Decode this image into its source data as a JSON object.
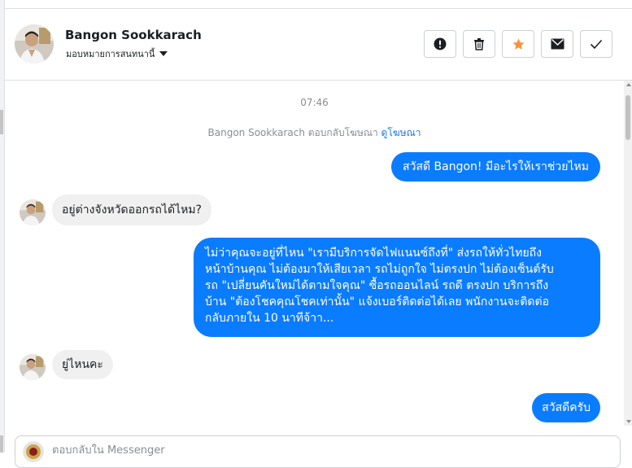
{
  "contact": {
    "name": "Bangon Sookkarach",
    "assign_label": "มอบหมายการสนทนานี้"
  },
  "toolbar": {
    "icons": [
      "exclamation-icon",
      "trash-icon",
      "star-icon",
      "envelope-icon",
      "check-icon"
    ],
    "star_color": "#f7923b"
  },
  "chat": {
    "timestamp": "07:46",
    "system_text": "Bangon Sookkarach ตอบกลับโฆษณา",
    "system_link": "ดูโฆษณา",
    "messages": [
      {
        "dir": "out",
        "text": "สวัสดี Bangon! มีอะไรให้เราช่วยไหม"
      },
      {
        "dir": "in",
        "text": "อยู่ต่างจังหวัดออกรถได้ไหม?"
      },
      {
        "dir": "out",
        "lines": [
          "ไม่ว่าคุณจะอยู่ที่ไหน \"เรามีบริการจัดไฟแนนซ์ถึงที่\"  ส่งรถให้ทั่วไทยถึง",
          "หน้าบ้านคุณ ไม่ต้องมาให้เสียเวลา รถไม่ถูกใจ ไม่ตรงปก ไม่ต้องเซ็นต์รับ",
          "รถ \"เปลี่ยนคันใหม่ได้ตามใจคุณ\" ซื้อรถออนไลน์ รถดี ตรงปก บริการถึง",
          "บ้าน \"ต้องโชคคุณโชคเท่านั้น\" แจ้งเบอร์ติดต่อได้เลย พนักงานจะติดต่อ",
          "กลับภายใน 10 นาทีจ้าา..."
        ]
      },
      {
        "dir": "in",
        "text": "ยู่ไหนคะ"
      },
      {
        "dir": "out",
        "text": "สวัสดีครับ"
      }
    ]
  },
  "composer": {
    "placeholder": "ตอบกลับใน Messenger"
  },
  "colors": {
    "outgoing_bubble": "#0a7cff",
    "incoming_bubble": "#f0f0f0",
    "link": "#1877f2"
  }
}
